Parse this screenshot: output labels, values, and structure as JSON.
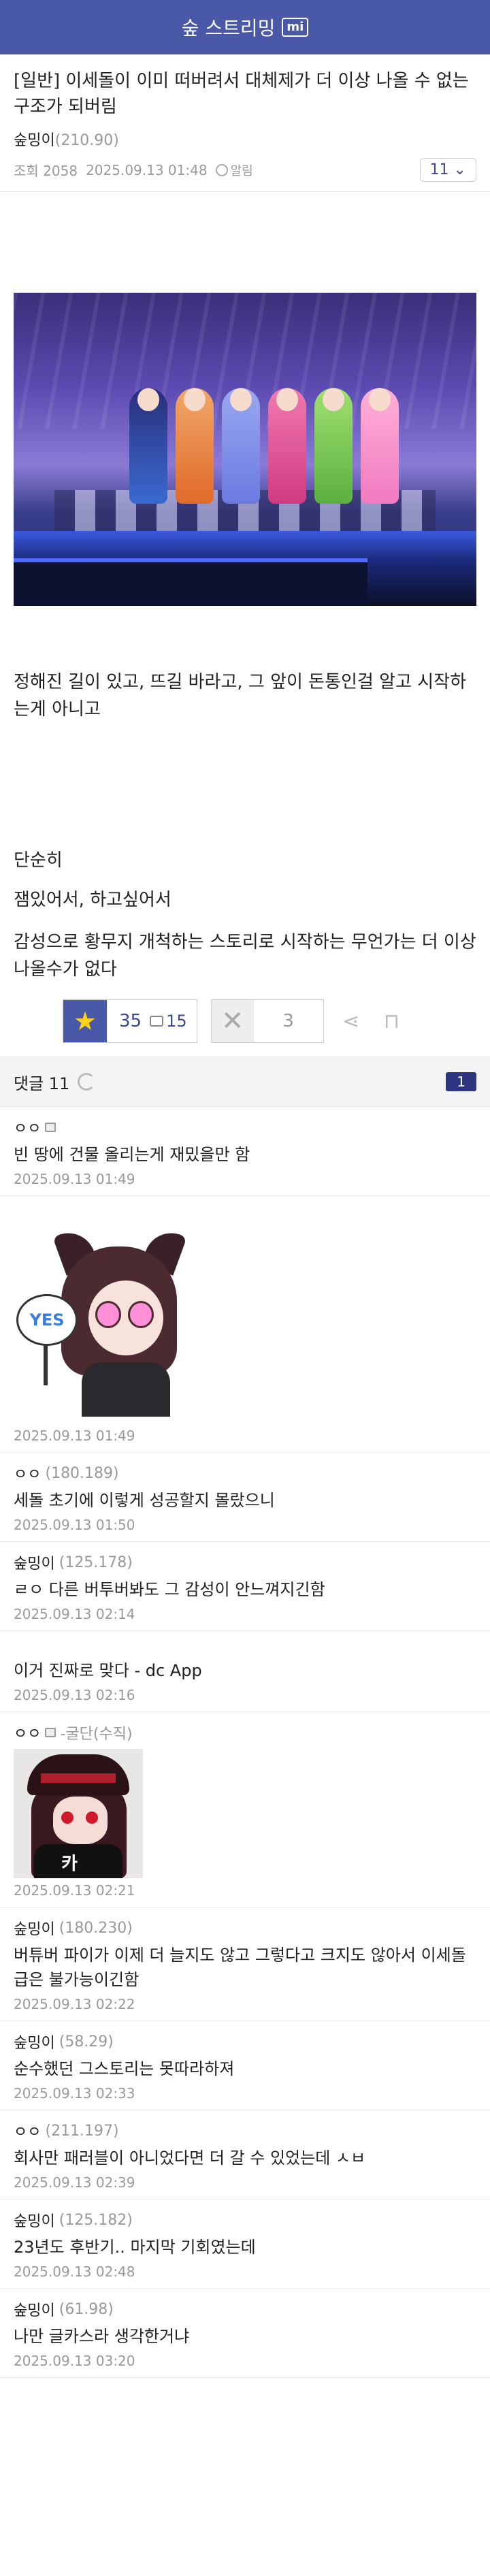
{
  "header": {
    "title": "숲 스트리밍",
    "badge": "mi"
  },
  "post": {
    "title": "[일반] 이세돌이 이미 떠버려서 대체제가 더 이상 나올 수 없는 구조가 되버림",
    "author": "숲밍이",
    "author_ip": "(210.90)",
    "views": "조회 2058",
    "datetime": "2025.09.13 01:48",
    "alarm_label": "알림",
    "comment_count_btn": "11",
    "paragraphs": {
      "p1": "정해진 길이 있고, 뜨길 바라고, 그 앞이 돈통인걸 알고 시작하는게 아니고",
      "p2": "단순히",
      "p3": "잼있어서, 하고싶어서",
      "p4": "감성으로 황무지 개척하는 스토리로 시작하는 무언가는 더 이상 나올수가 없다"
    },
    "recommend": {
      "count": "35",
      "fixed_count": "15"
    },
    "nonrecommend": {
      "count": "3"
    }
  },
  "comments_header": {
    "label": "댓글 11",
    "page": "1"
  },
  "comments": [
    {
      "nick": "ㅇㅇ",
      "ip": "",
      "text": "빈 땅에 건물 올리는게 재밌을만 함",
      "time": "2025.09.13 01:49"
    },
    {
      "nick": "",
      "ip": "",
      "text": "",
      "time": "2025.09.13 01:49",
      "sticker_text": "YES"
    },
    {
      "nick": "ㅇㅇ",
      "ip": "(180.189)",
      "text": "세돌 초기에 이렇게 성공할지 몰랐으니",
      "time": "2025.09.13 01:50"
    },
    {
      "nick": "숲밍이",
      "ip": "(125.178)",
      "text": "ㄹㅇ 다른 버투버봐도 그 감성이 안느껴지긴함",
      "time": "2025.09.13 02:14"
    },
    {
      "nick": "",
      "ip": "",
      "text": "이거 진짜로 맞다 - dc App",
      "time": "2025.09.13 02:16"
    },
    {
      "nick": "ㅇㅇ",
      "ip": "-굴단(수직)",
      "text": "",
      "time": "2025.09.13 02:21",
      "sticker_text": "카"
    },
    {
      "nick": "숲밍이",
      "ip": "(180.230)",
      "text": "버튜버 파이가 이제 더 늘지도 않고 그렇다고 크지도 않아서 이세돌급은 불가능이긴함",
      "time": "2025.09.13 02:22"
    },
    {
      "nick": "숲밍이",
      "ip": "(58.29)",
      "text": "순수했던 그스토리는 못따라하져",
      "time": "2025.09.13 02:33"
    },
    {
      "nick": "ㅇㅇ",
      "ip": "(211.197)",
      "text": "회사만 패러블이 아니었다면 더 갈 수 있었는데 ㅅㅂ",
      "time": "2025.09.13 02:39"
    },
    {
      "nick": "숲밍이",
      "ip": "(125.182)",
      "text": "23년도 후반기.. 마지막 기회였는데",
      "time": "2025.09.13 02:48"
    },
    {
      "nick": "숲밍이",
      "ip": "(61.98)",
      "text": "나만 글카스라 생각한거냐",
      "time": "2025.09.13 03:20"
    }
  ],
  "icons": {
    "star": "star-icon",
    "nonrec": "x-icon",
    "share": "share-icon",
    "bookmark": "bookmark-icon",
    "refresh": "refresh-icon"
  },
  "colors": {
    "brand": "#4a58a8",
    "accent": "#3b4890",
    "star": "#ffd21a"
  }
}
